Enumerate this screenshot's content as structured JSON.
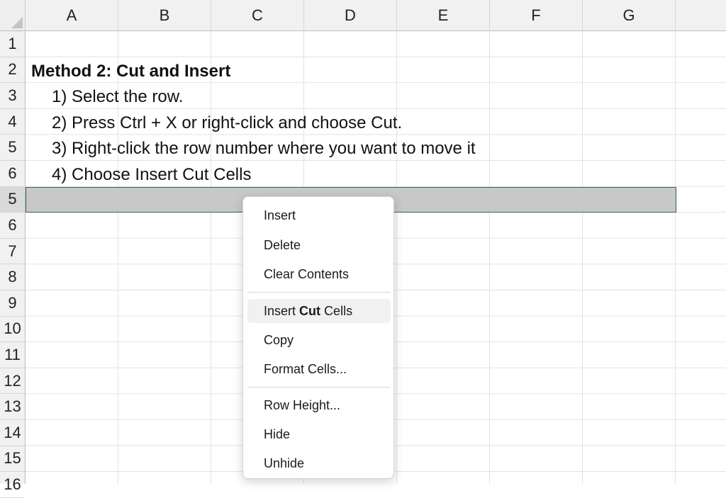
{
  "columns": [
    "A",
    "B",
    "C",
    "D",
    "E",
    "F",
    "G"
  ],
  "rows": [
    "1",
    "2",
    "3",
    "4",
    "5",
    "6",
    "5",
    "6",
    "7",
    "8",
    "9",
    "10",
    "11",
    "12",
    "13",
    "14",
    "15",
    "16"
  ],
  "cells": {
    "heading": "Method 2: Cut and Insert",
    "step1": "1) Select the row.",
    "step2": "2) Press Ctrl + X or right-click and choose Cut.",
    "step3": "3) Right-click the row number where you want to move it",
    "step4": "4) Choose Insert Cut Cells"
  },
  "context_menu": {
    "insert": "Insert",
    "delete": "Delete",
    "clear_contents": "Clear Contents",
    "insert_cut_cells_pre": "Insert",
    "insert_cut_cells_bold": "Cut",
    "insert_cut_cells_post": "Cells",
    "copy": "Copy",
    "format_cells": "Format Cells...",
    "row_height": "Row Height...",
    "hide": "Hide",
    "unhide": "Unhide"
  },
  "colors": {
    "selection_border": "#2e6b3f",
    "selection_fill": "#c8c8c8"
  }
}
